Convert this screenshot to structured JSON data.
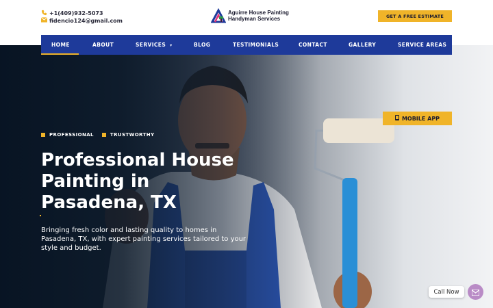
{
  "header": {
    "phone": "+1(409)932-5073",
    "email": "fidencio124@gmail.com",
    "logo_line1": "Aguirre House Painting",
    "logo_line2": "Handyman Services",
    "cta_label": "GET A FREE ESTIMATE"
  },
  "nav": {
    "items": [
      {
        "label": "HOME"
      },
      {
        "label": "ABOUT"
      },
      {
        "label": "SERVICES"
      },
      {
        "label": "BLOG"
      },
      {
        "label": "TESTIMONIALS"
      },
      {
        "label": "CONTACT"
      },
      {
        "label": "GALLERY"
      },
      {
        "label": "SERVICE AREAS"
      }
    ],
    "active": "HOME"
  },
  "hero": {
    "tags": [
      "PROFESSIONAL",
      "TRUSTWORTHY"
    ],
    "headline_1": "Professional House",
    "headline_2": "Painting in",
    "headline_3": "Pasadena, TX",
    "subtext": "Bringing fresh color and lasting quality to homes in Pasadena, TX, with expert painting services tailored to your style and budget.",
    "mobile_app_label": "MOBILE APP"
  },
  "widget": {
    "call_now_label": "Call Now"
  },
  "colors": {
    "accent": "#f0b429",
    "nav_bg": "#1e3a9a",
    "hero_dark": "#0d1a2b"
  }
}
